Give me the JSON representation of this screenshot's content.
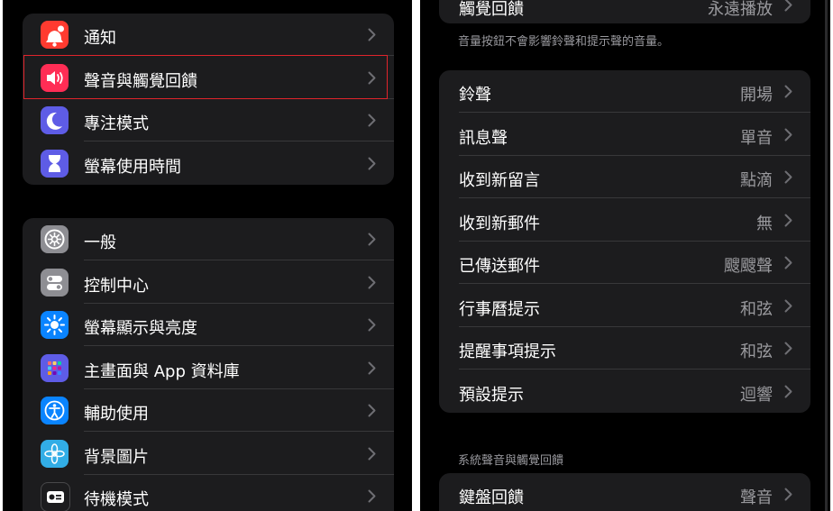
{
  "left": {
    "group1": [
      {
        "label": "通知",
        "icon": "bell-badge-icon",
        "color": "#ff3b30"
      },
      {
        "label": "聲音與觸覺回饋",
        "icon": "speaker-wave-icon",
        "color": "#ff2d55"
      },
      {
        "label": "專注模式",
        "icon": "moon-icon",
        "color": "#5e5ce6"
      },
      {
        "label": "螢幕使用時間",
        "icon": "hourglass-icon",
        "color": "#5e5ce6"
      }
    ],
    "group2": [
      {
        "label": "一般",
        "icon": "gear-icon",
        "color": "#8e8e93"
      },
      {
        "label": "控制中心",
        "icon": "toggles-icon",
        "color": "#8e8e93"
      },
      {
        "label": "螢幕顯示與亮度",
        "icon": "sun-icon",
        "color": "#0a84ff"
      },
      {
        "label": "主畫面與 App 資料庫",
        "icon": "app-grid-icon",
        "color": "#5e5ce6"
      },
      {
        "label": "輔助使用",
        "icon": "accessibility-icon",
        "color": "#0a84ff"
      },
      {
        "label": "背景圖片",
        "icon": "flower-icon",
        "color": "#32ade6"
      },
      {
        "label": "待機模式",
        "icon": "standby-icon",
        "color": "#1c1c1e"
      }
    ],
    "highlight_color": "#e0242b"
  },
  "right": {
    "top_row": {
      "label": "觸覺回饋",
      "value": "永遠播放"
    },
    "note": "音量按鈕不會影響鈴聲和提示聲的音量。",
    "sounds": [
      {
        "label": "鈴聲",
        "value": "開場"
      },
      {
        "label": "訊息聲",
        "value": "單音"
      },
      {
        "label": "收到新留言",
        "value": "點滴"
      },
      {
        "label": "收到新郵件",
        "value": "無"
      },
      {
        "label": "已傳送郵件",
        "value": "颼颼聲"
      },
      {
        "label": "行事曆提示",
        "value": "和弦"
      },
      {
        "label": "提醒事項提示",
        "value": "和弦"
      },
      {
        "label": "預設提示",
        "value": "迴響"
      }
    ],
    "section_header": "系統聲音與觸覺回饋",
    "bottom_row": {
      "label": "鍵盤回饋",
      "value": "聲音"
    }
  }
}
